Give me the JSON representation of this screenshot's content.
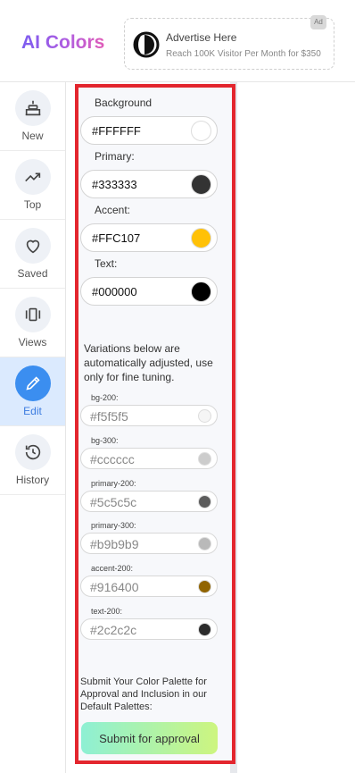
{
  "header": {
    "logo": "AI Colors",
    "logo_gradient": [
      "#7b5cf0",
      "#e05cb8"
    ],
    "ad": {
      "badge": "Ad",
      "icon": "half-moon-icon",
      "title": "Advertise Here",
      "subtitle": "Reach 100K Visitor Per Month for $350"
    }
  },
  "sidebar": {
    "items": [
      {
        "label": "New",
        "icon": "cake-icon"
      },
      {
        "label": "Top",
        "icon": "trending-up-icon"
      },
      {
        "label": "Saved",
        "icon": "heart-icon"
      },
      {
        "label": "Views",
        "icon": "view-carousel-icon"
      },
      {
        "label": "Edit",
        "icon": "pencil-icon",
        "active": true
      },
      {
        "label": "History",
        "icon": "history-icon"
      }
    ],
    "active_color": "#3b8ef0"
  },
  "editor": {
    "fields": [
      {
        "label": "Background",
        "value": "#FFFFFF",
        "color": "#FFFFFF"
      },
      {
        "label": "Primary:",
        "value": "#333333",
        "color": "#333333"
      },
      {
        "label": "Accent:",
        "value": "#FFC107",
        "color": "#FFC107"
      },
      {
        "label": "Text:",
        "value": "#000000",
        "color": "#000000"
      }
    ],
    "note": "Variations below are automatically adjusted, use only for fine tuning.",
    "variations": [
      {
        "label": "bg-200:",
        "value": "#f5f5f5",
        "color": "#f5f5f5"
      },
      {
        "label": "bg-300:",
        "value": "#cccccc",
        "color": "#cccccc"
      },
      {
        "label": "primary-200:",
        "value": "#5c5c5c",
        "color": "#5c5c5c"
      },
      {
        "label": "primary-300:",
        "value": "#b9b9b9",
        "color": "#b9b9b9"
      },
      {
        "label": "accent-200:",
        "value": "#916400",
        "color": "#916400"
      },
      {
        "label": "text-200:",
        "value": "#2c2c2c",
        "color": "#2c2c2c"
      }
    ],
    "submit_note": "Submit Your Color Palette for Approval and Inclusion in our Default Palettes:",
    "submit_label": "Submit for approval"
  }
}
